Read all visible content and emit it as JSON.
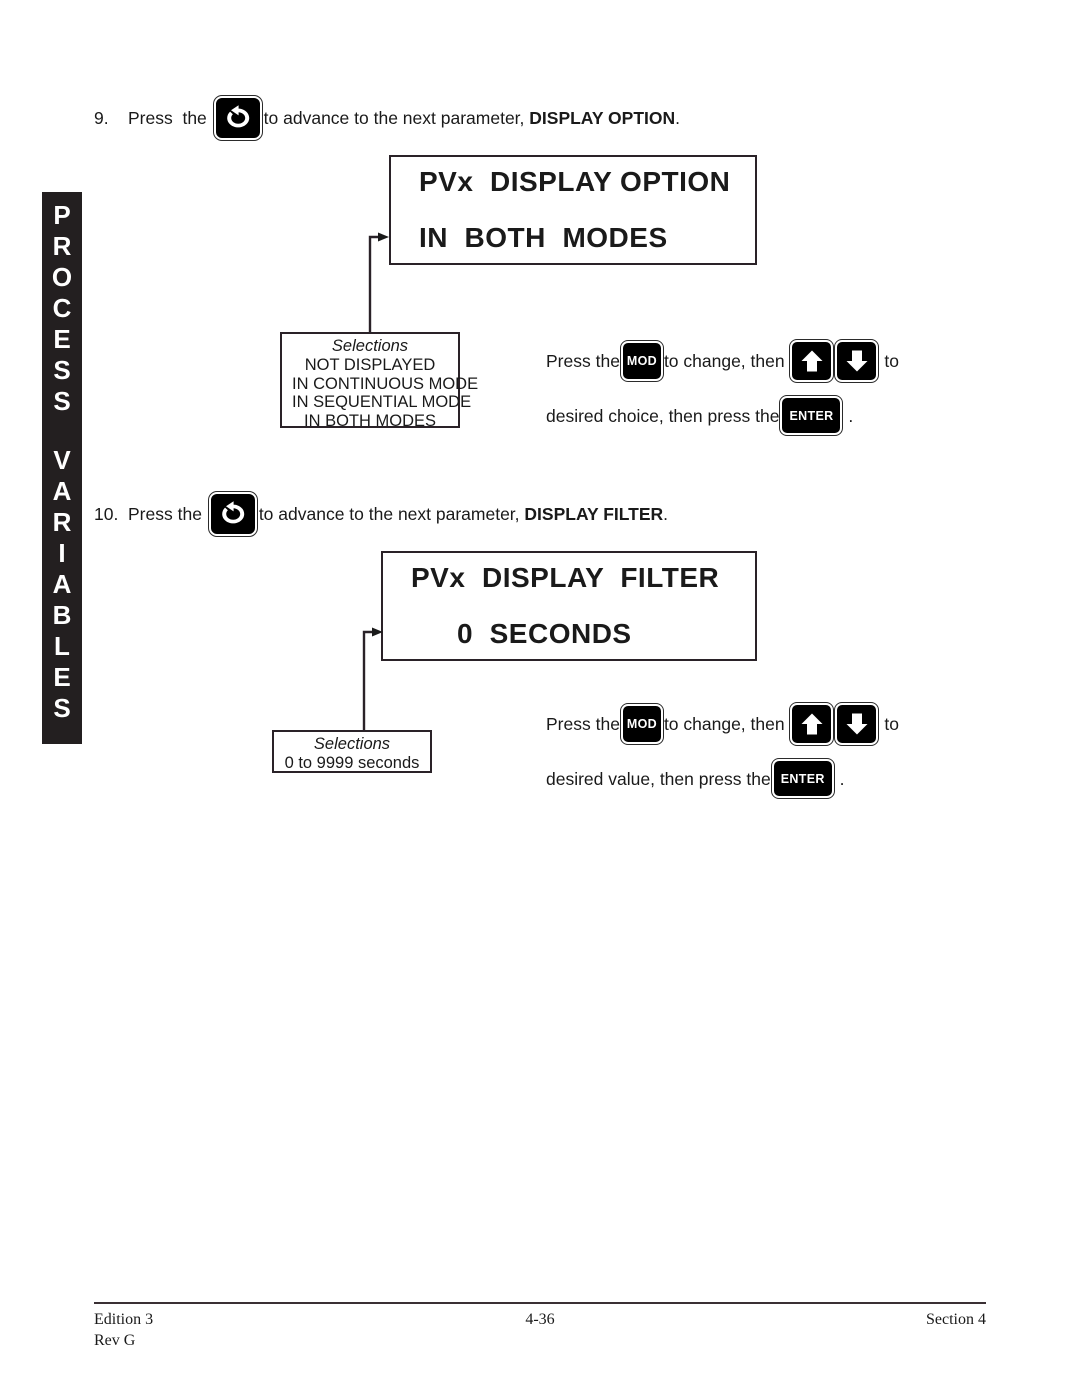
{
  "side_tab": {
    "label": "PROCESS VARIABLES",
    "line1": "PROCESS",
    "line2": "VARIABLES"
  },
  "steps": [
    {
      "number": "9.",
      "text_before": "Press  the",
      "icon": "advance-key-icon",
      "text_after_plain": "to advance to the next parameter, ",
      "text_after_bold": "DISPLAY OPTION",
      "period": "."
    },
    {
      "number": "10.",
      "text_before": "Press the",
      "icon": "advance-key-icon",
      "text_after_plain": "to advance to the next parameter, ",
      "text_after_bold": "DISPLAY FILTER",
      "period": "."
    }
  ],
  "displays": [
    {
      "line1": "PVx  DISPLAY OPTION",
      "line2": "IN  BOTH  MODES"
    },
    {
      "line1": "PVx  DISPLAY  FILTER",
      "line2": "0  SECONDS"
    }
  ],
  "selections": [
    {
      "header": "Selections",
      "options": [
        "NOT DISPLAYED",
        "IN CONTINUOUS MODE",
        "IN SEQUENTIAL MODE",
        "IN BOTH MODES"
      ]
    },
    {
      "header": "Selections",
      "options": [
        "0 to 9999 seconds"
      ]
    }
  ],
  "instructions": [
    {
      "line1_a": "Press the",
      "mod_label": "MOD",
      "line1_b": "to change, then ",
      "up_icon": "arrow-up-key-icon",
      "down_icon": "arrow-down-key-icon",
      "line1_c": " to",
      "line2_a": "desired choice, then press the",
      "enter_label": "ENTER",
      "line2_b": " ."
    },
    {
      "line1_a": "Press the",
      "mod_label": "MOD",
      "line1_b": "to change, then ",
      "up_icon": "arrow-up-key-icon",
      "down_icon": "arrow-down-key-icon",
      "line1_c": " to",
      "line2_a": "desired value, then press the",
      "enter_label": "ENTER",
      "line2_b": " ."
    }
  ],
  "footer": {
    "edition": "Edition 3",
    "revision": "Rev G",
    "page_number": "4-36",
    "section": "Section 4"
  },
  "colors": {
    "ink": "#1a1a1a",
    "tab_background": "#231f20",
    "box_border": "#2a2228",
    "key_background": "#000000",
    "page_background": "#ffffff"
  }
}
